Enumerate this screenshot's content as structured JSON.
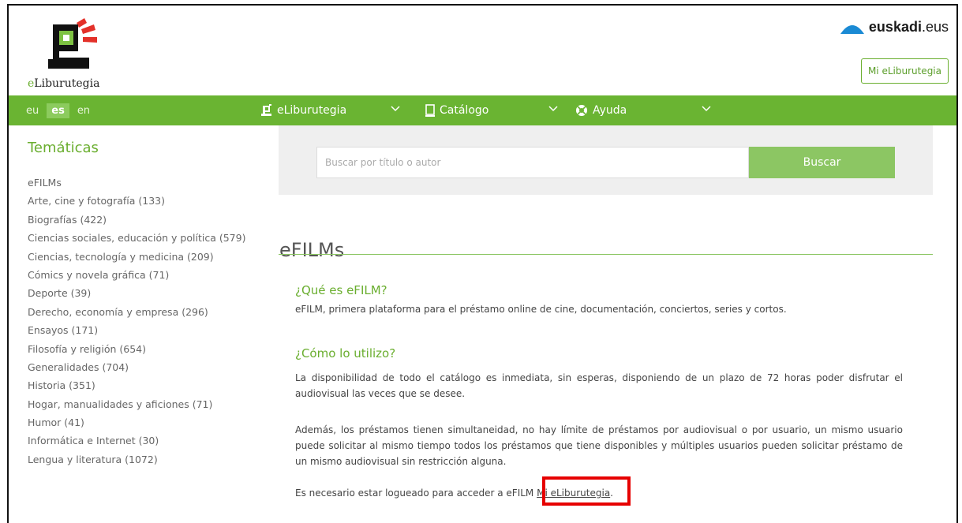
{
  "header": {
    "logo_text_e": "e",
    "logo_text_rest": "Liburutegia",
    "euskadi_brand": "euskadi",
    "euskadi_tld": ".eus",
    "mi_button": "Mi eLiburutegia"
  },
  "nav": {
    "languages": [
      {
        "label": "eu",
        "active": false
      },
      {
        "label": "es",
        "active": true
      },
      {
        "label": "en",
        "active": false
      }
    ],
    "menu": [
      {
        "label": "eLiburutegia",
        "icon": "eliburutegia-icon"
      },
      {
        "label": "Catálogo",
        "icon": "book-icon"
      },
      {
        "label": "Ayuda",
        "icon": "lifebuoy-icon"
      }
    ]
  },
  "sidebar": {
    "title": "Temáticas",
    "items": [
      "eFILMs",
      "Arte, cine y fotografía (133)",
      "Biografías (422)",
      "Ciencias sociales, educación y política (579)",
      "Ciencias, tecnología y medicina (209)",
      "Cómics y novela gráfica (71)",
      "Deporte (39)",
      "Derecho, economía y empresa (296)",
      "Ensayos (171)",
      "Filosofía y religión (654)",
      "Generalidades (704)",
      "Historia (351)",
      "Hogar, manualidades y aficiones (71)",
      "Humor (41)",
      "Informática e Internet (30)",
      "Lengua y literatura (1072)"
    ]
  },
  "search": {
    "placeholder": "Buscar por título o autor",
    "button": "Buscar"
  },
  "main": {
    "title": "eFILMs",
    "q1": "¿Qué es eFILM?",
    "a1": "eFILM, primera plataforma para el préstamo online de cine, documentación, conciertos, series y cortos.",
    "q2": "¿Cómo lo utilizo?",
    "p1": "La disponibilidad de todo el catálogo es inmediata, sin esperas, disponiendo de un plazo de 72 horas poder disfrutar el audiovisual las veces que se desee.",
    "p2": "Además, los préstamos tienen simultaneidad, no hay límite de préstamos por audiovisual o por usuario, un mismo usuario puede solicitar al mismo tiempo todos los préstamos que tiene disponibles y múltiples usuarios pueden solicitar préstamo de un mismo audiovisual sin restricción alguna.",
    "p3_prefix": "Es necesario estar logueado para acceder a eFILM",
    "p3_link": "Mi eLiburutegia",
    "p3_suffix": "."
  },
  "colors": {
    "brand_green": "#6ab432",
    "highlight_red": "#e60000"
  }
}
